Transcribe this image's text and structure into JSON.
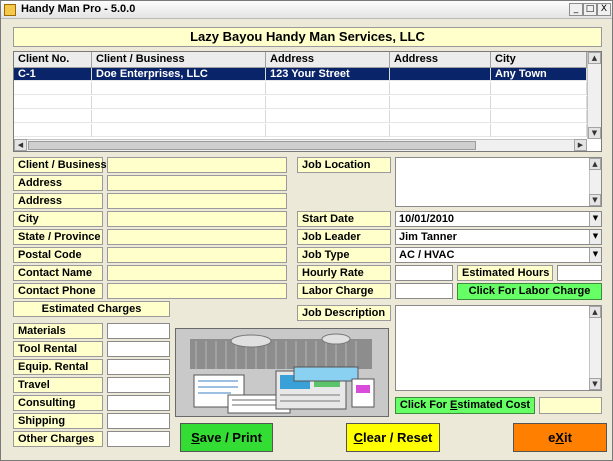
{
  "window": {
    "title": "Handy Man Pro  -  5.0.0",
    "min_label": "_",
    "max_label": "□",
    "close_label": "X"
  },
  "company": "Lazy Bayou Handy Man Services, LLC",
  "grid": {
    "headers": [
      "Client No.",
      "Client / Business",
      "Address",
      "Address",
      "City"
    ],
    "rows": [
      [
        "C-1",
        "Doe Enterprises, LLC",
        "123 Your Street",
        "",
        "Any Town"
      ]
    ]
  },
  "client_labels": {
    "client_business": "Client / Business",
    "address1": "Address",
    "address2": "Address",
    "city": "City",
    "state": "State / Province",
    "postal": "Postal Code",
    "contact_name": "Contact  Name",
    "contact_phone": "Contact Phone"
  },
  "estimated": {
    "heading": "Estimated Charges",
    "materials": "Materials",
    "tool_rental": "Tool Rental",
    "equip_rental": "Equip. Rental",
    "travel": "Travel",
    "consulting": "Consulting",
    "shipping": "Shipping",
    "other": "Other Charges"
  },
  "job": {
    "location_label": "Job Location",
    "start_date_label": "Start Date",
    "start_date": "10/01/2010",
    "leader_label": "Job Leader",
    "leader": "Jim Tanner",
    "type_label": "Job Type",
    "type": "AC / HVAC",
    "hourly_rate_label": "Hourly Rate",
    "est_hours_label": "Estimated Hours",
    "labor_charge_label": "Labor Charge",
    "labor_btn": "Click For Labor Charge",
    "description_label": "Job Description",
    "est_cost_btn_pre": "Click For ",
    "est_cost_btn_u": "E",
    "est_cost_btn_post": "stimated  Cost"
  },
  "buttons": {
    "save_u": "S",
    "save_rest": "ave / Print",
    "clear_u": "C",
    "clear_rest": "lear / Reset",
    "exit_pre": "e",
    "exit_u": "X",
    "exit_post": "it"
  },
  "colors": {
    "field_bg": "#ffffcc",
    "selection": "#0a246a",
    "save_btn": "#33dd33",
    "clear_btn": "#ffff00",
    "exit_btn": "#ff8000",
    "action_btn": "#66ff66"
  }
}
